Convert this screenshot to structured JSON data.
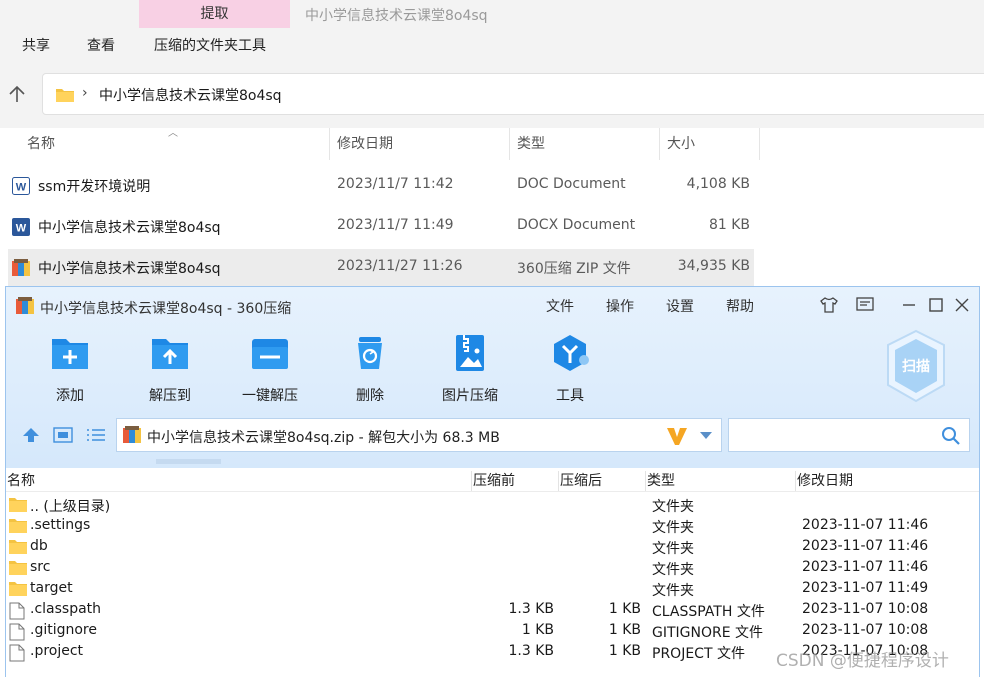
{
  "explorer": {
    "context_tab": "提取",
    "window_title": "中小学信息技术云课堂8o4sq",
    "ribbon_tabs": [
      "共享",
      "查看",
      "压缩的文件夹工具"
    ],
    "address_crumb": "中小学信息技术云课堂8o4sq",
    "columns": {
      "name": "名称",
      "date": "修改日期",
      "type": "类型",
      "size": "大小"
    },
    "files": [
      {
        "name": "ssm开发环境说明",
        "date": "2023/11/7 11:42",
        "type": "DOC Document",
        "size": "4,108 KB",
        "icon": "word-doc-icon"
      },
      {
        "name": "中小学信息技术云课堂8o4sq",
        "date": "2023/11/7 11:49",
        "type": "DOCX Document",
        "size": "81 KB",
        "icon": "word-docx-icon"
      },
      {
        "name": "中小学信息技术云课堂8o4sq",
        "date": "2023/11/27 11:26",
        "type": "360压缩 ZIP 文件",
        "size": "34,935 KB",
        "icon": "zip-archive-icon"
      }
    ]
  },
  "zip": {
    "title": "中小学信息技术云课堂8o4sq - 360压缩",
    "menu": [
      "文件",
      "操作",
      "设置",
      "帮助"
    ],
    "toolbar": [
      "添加",
      "解压到",
      "一键解压",
      "删除",
      "图片压缩",
      "工具"
    ],
    "scan_label": "扫描",
    "path": "中小学信息技术云课堂8o4sq.zip - 解包大小为 68.3 MB",
    "search_placeholder": "",
    "columns": {
      "name": "名称",
      "before": "压缩前",
      "after": "压缩后",
      "type": "类型",
      "date": "修改日期"
    },
    "entries": [
      {
        "name": ".. (上级目录)",
        "before": "",
        "after": "",
        "type": "文件夹",
        "date": "",
        "kind": "folder"
      },
      {
        "name": ".settings",
        "before": "",
        "after": "",
        "type": "文件夹",
        "date": "2023-11-07 11:46",
        "kind": "folder"
      },
      {
        "name": "db",
        "before": "",
        "after": "",
        "type": "文件夹",
        "date": "2023-11-07 11:46",
        "kind": "folder"
      },
      {
        "name": "src",
        "before": "",
        "after": "",
        "type": "文件夹",
        "date": "2023-11-07 11:46",
        "kind": "folder"
      },
      {
        "name": "target",
        "before": "",
        "after": "",
        "type": "文件夹",
        "date": "2023-11-07 11:49",
        "kind": "folder"
      },
      {
        "name": ".classpath",
        "before": "1.3 KB",
        "after": "1 KB",
        "type": "CLASSPATH 文件",
        "date": "2023-11-07 10:08",
        "kind": "file"
      },
      {
        "name": ".gitignore",
        "before": "1 KB",
        "after": "1 KB",
        "type": "GITIGNORE 文件",
        "date": "2023-11-07 10:08",
        "kind": "file"
      },
      {
        "name": ".project",
        "before": "1.3 KB",
        "after": "1 KB",
        "type": "PROJECT 文件",
        "date": "2023-11-07 10:08",
        "kind": "file"
      }
    ]
  },
  "watermark": "CSDN @便捷程序设计",
  "colors": {
    "ctx_tab": "#f8d0e4",
    "zip_head": "#d5e8fb",
    "accent_blue": "#1e88e5",
    "folder_yellow": "#f4c342"
  }
}
